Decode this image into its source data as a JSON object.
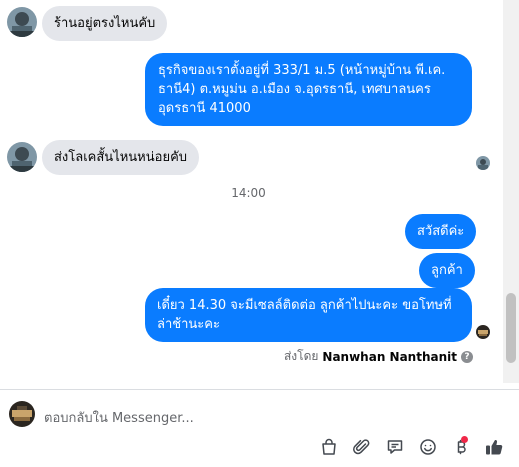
{
  "messages": {
    "in1": "ร้านอยู่ตรงไหนคับ",
    "out1": "ธุรกิจของเราตั้งอยู่ที่ 333/1 ม.5 (หน้าหมู่บ้าน พี.เค. ธานี4) ต.หมูม่น อ.เมือง จ.อุดรธานี, เทศบาลนคร อุดรธานี 41000",
    "in2": "ส่งโลเคสั้นไหนหน่อยคับ",
    "timestamp": "14:00",
    "out2": "สวัสดีค่ะ",
    "out3": "ลูกค้า",
    "out4": "เดี๋ยว 14.30 จะมีเซลล์ติดต่อ ลูกค้าไปนะคะ ขอโทษที่ล่าช้านะคะ"
  },
  "sent_by": {
    "prefix": "ส่งโดย",
    "name": "Nanwhan Nanthanit",
    "help_glyph": "?"
  },
  "composer": {
    "placeholder": "ตอบกลับใน Messenger..."
  },
  "icons": [
    "shopping-bag-icon",
    "paperclip-icon",
    "saved-reply-icon",
    "emoji-icon",
    "payment-icon",
    "like-icon"
  ],
  "colors": {
    "outgoing_bubble": "#0a7cff",
    "incoming_bubble": "#e4e6eb",
    "notification_dot": "#f02849",
    "muted_text": "#65676b"
  }
}
